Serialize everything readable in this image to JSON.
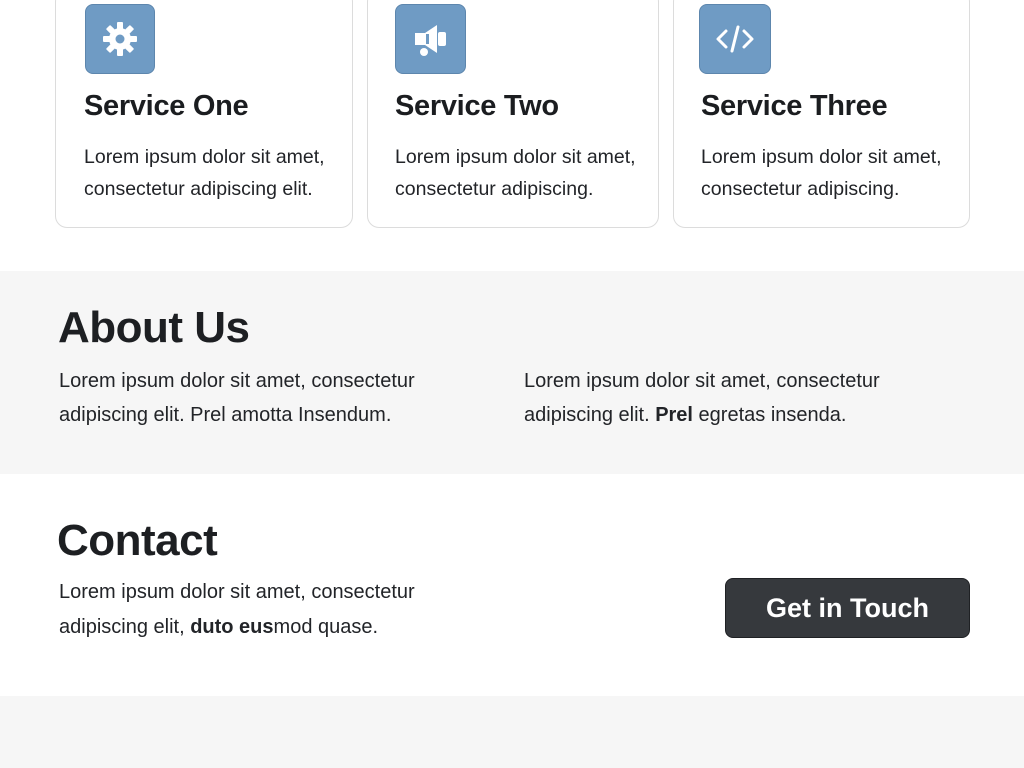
{
  "services": [
    {
      "icon": "gear-icon",
      "title": "Service One",
      "description": "Lorem ipsum dolor sit amet, consectetur adipiscing elit."
    },
    {
      "icon": "megaphone-icon",
      "title": "Service Two",
      "description": "Lorem ipsum dolor sit amet, consectetur adipiscing."
    },
    {
      "icon": "code-icon",
      "title": "Service Three",
      "description": "Lorem ipsum dolor sit amet, consectetur adipiscing."
    }
  ],
  "about": {
    "heading": "About Us",
    "col1": "Lorem ipsum dolor sit amet, consectetur adipiscing elit. Prel amotta Insendum.",
    "col2_before": "Lorem ipsum dolor sit amet, consectetur adipiscing elit. ",
    "col2_bold": "Prel",
    "col2_after": " egretas insenda."
  },
  "contact": {
    "heading": "Contact",
    "text_before": "Lorem ipsum dolor sit amet, consectetur adipiscing elit, ",
    "text_bold": "duto eus",
    "text_after": "mod quase.",
    "button_label": "Get in Touch"
  },
  "colors": {
    "icon_tile": "#6f9bc4",
    "cta_background": "#36393d",
    "section_alt_background": "#f6f6f6"
  }
}
